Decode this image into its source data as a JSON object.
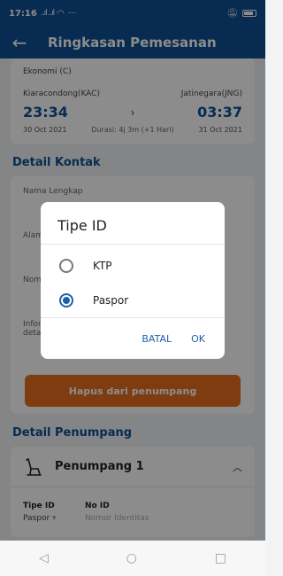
{
  "status_bar": {
    "time": "17:16",
    "signal": "..ıl ..ıl",
    "more": "···"
  },
  "app_bar": {
    "title": "Ringkasan Pemesanan"
  },
  "trip": {
    "class": "Ekonomi (C)",
    "origin": "Kiaracondong(KAC)",
    "destination": "Jatinegara(JNG)",
    "depart_time": "23:34",
    "arrive_time": "03:37",
    "depart_date": "30 Oct 2021",
    "arrive_date": "31 Oct 2021",
    "duration": "Durasi: 4j 3m (+1 Hari)"
  },
  "contact": {
    "section_title": "Detail Kontak",
    "fields": [
      "Nama Lengkap",
      "Alam",
      "Nom",
      "Infor\ndeta"
    ],
    "delete_button": "Hapus dari penumpang"
  },
  "passenger": {
    "section_title": "Detail Penumpang",
    "title": "Penumpang 1",
    "id_type_label": "Tipe ID",
    "id_type_value": "Paspor",
    "id_no_label": "No ID",
    "id_no_placeholder": "Nomor Identitas"
  },
  "dialog": {
    "title": "Tipe ID",
    "options": [
      "KTP",
      "Paspor"
    ],
    "selected": "Paspor",
    "cancel": "BATAL",
    "ok": "OK"
  }
}
